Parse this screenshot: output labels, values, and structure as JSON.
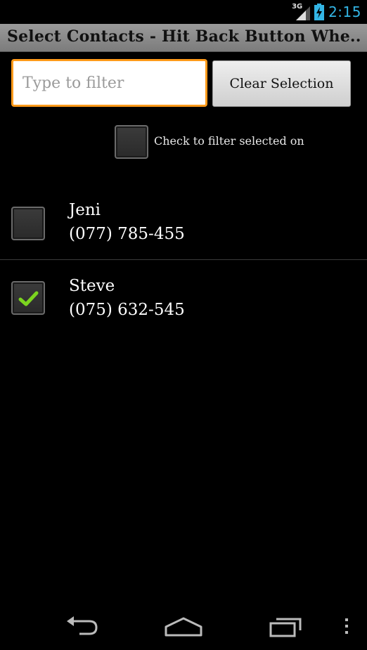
{
  "status_bar": {
    "network": "3G",
    "time": "2:15",
    "icons": [
      "signal-icon",
      "battery-charging-icon"
    ]
  },
  "title_bar": {
    "title": "Select Contacts - Hit Back Button Whe..."
  },
  "filter": {
    "placeholder": "Type to filter",
    "value": "",
    "clear_button_label": "Clear Selection",
    "selected_only_label": "Check to filter selected only",
    "selected_only_checked": false
  },
  "contacts": [
    {
      "name": "Jeni",
      "phone": "(077) 785-455",
      "checked": false
    },
    {
      "name": "Steve",
      "phone": "(075) 632-545",
      "checked": true
    }
  ],
  "nav_bar": {
    "icons": [
      "back-icon",
      "home-icon",
      "recent-apps-icon",
      "overflow-menu-icon"
    ]
  },
  "colors": {
    "accent": "#33b5e5",
    "focus_border": "#ff9a1a",
    "checkmark": "#7bd41f",
    "title_bar": "#8a8a8a"
  }
}
